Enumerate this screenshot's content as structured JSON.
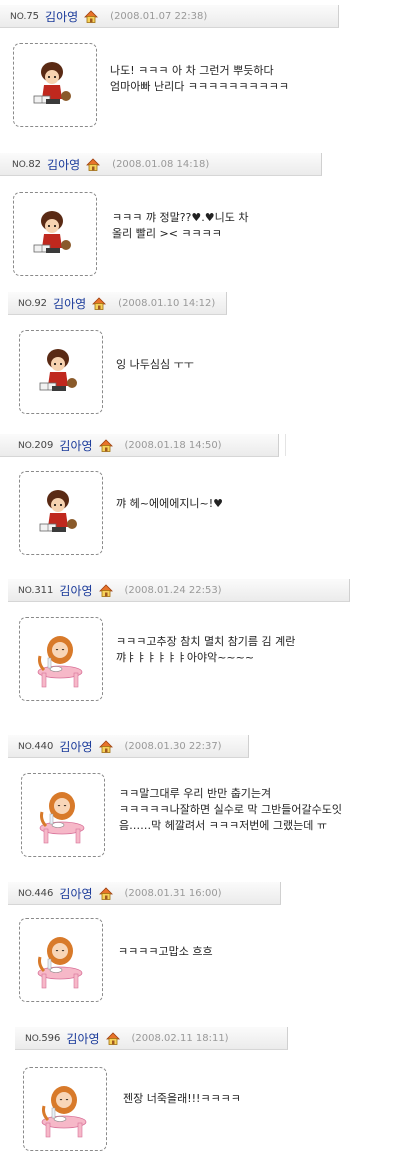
{
  "comments": [
    {
      "no_prefix": "NO.",
      "no": "75",
      "name": "김아영",
      "date": "(2008.01.07 22:38)",
      "avatar": "boy-reading",
      "text": "나도! ㅋㅋㅋ 아 차 그런거 뿌듯하다\n엄마아빠 난리다 ㅋㅋㅋㅋㅋㅋㅋㅋㅋㅋ"
    },
    {
      "no_prefix": "NO.",
      "no": "82",
      "name": "김아영",
      "date": "(2008.01.08 14:18)",
      "avatar": "boy-reading",
      "text": "ㅋㅋㅋ 꺄 정말??♥.♥니도 차\n올리 빨리 >< ㅋㅋㅋㅋ"
    },
    {
      "no_prefix": "NO.",
      "no": "92",
      "name": "김아영",
      "date": "(2008.01.10 14:12)",
      "avatar": "boy-reading",
      "text": "잉 나두심심 ㅜㅜ"
    },
    {
      "no_prefix": "NO.",
      "no": "209",
      "name": "김아영",
      "date": "(2008.01.18 14:50)",
      "avatar": "boy-reading",
      "text": "꺄 헤~에에에지니~!♥"
    },
    {
      "no_prefix": "NO.",
      "no": "311",
      "name": "김아영",
      "date": "(2008.01.24 22:53)",
      "avatar": "girl-eating",
      "text": "ㅋㅋㅋ고추장 참치 멸치 참기름 김 계란\n꺄ㅑㅑㅑㅑㅑㅑ아야악~~~~"
    },
    {
      "no_prefix": "NO.",
      "no": "440",
      "name": "김아영",
      "date": "(2008.01.30 22:37)",
      "avatar": "girl-eating",
      "text": "ㅋㅋ말그대루 우리 반만 춥기는겨\nㅋㅋㅋㅋㅋ나잘하면 실수로 막 그반들어갈수도잇\n음……막 헤깔려서 ㅋㅋㅋ저번에 그랬는데 ㅠ"
    },
    {
      "no_prefix": "NO.",
      "no": "446",
      "name": "김아영",
      "date": "(2008.01.31 16:00)",
      "avatar": "girl-eating",
      "text": "ㅋㅋㅋㅋ고맙소 흐흐"
    },
    {
      "no_prefix": "NO.",
      "no": "596",
      "name": "김아영",
      "date": "(2008.02.11 18:11)",
      "avatar": "girl-eating",
      "text": "젠장 너죽을래!!!ㅋㅋㅋㅋ"
    }
  ]
}
